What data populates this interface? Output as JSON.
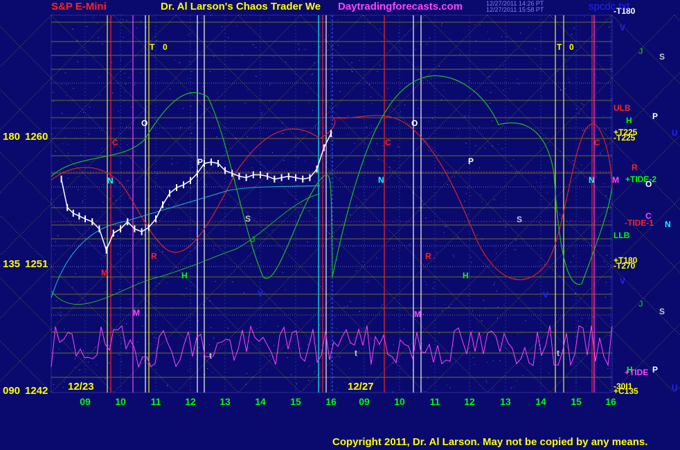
{
  "header": {
    "symbol": "S&P E-Mini",
    "title": "Dr. Al Larson's Chaos Trader We",
    "site": "Daytradingforecasts.com",
    "timestamp1": "12/27/2011 14:26 PT",
    "timestamp2": "12/27/2011 15:58 PT",
    "file": "spcdc.txt"
  },
  "copyright": "Copyright 2011, Dr. Al Larson. May not be copied by any means.",
  "colors": {
    "background": "#0a0a6e",
    "grid": "#b0b000",
    "sides": "#00aa44",
    "yellow_text": "#ffff00",
    "magenta_text": "#ff44ff"
  },
  "chart_data": {
    "type": "line",
    "y_axis_labels": [
      {
        "angle": "180",
        "price": "1260"
      },
      {
        "angle": "135",
        "price": "1251"
      },
      {
        "angle": "090",
        "price": "1242"
      }
    ],
    "ylim": [
      1242,
      1260
    ],
    "x_tick_labels": [
      "09",
      "10",
      "11",
      "12",
      "13",
      "14",
      "15",
      "16",
      "09",
      "10",
      "11",
      "12",
      "13",
      "14",
      "15",
      "16"
    ],
    "date_labels": [
      "12/23",
      "12/27"
    ],
    "price_series": [
      {
        "x": 8.2,
        "y": 1257.0
      },
      {
        "x": 8.4,
        "y": 1255.0
      },
      {
        "x": 8.6,
        "y": 1254.6
      },
      {
        "x": 8.8,
        "y": 1254.4
      },
      {
        "x": 9.0,
        "y": 1254.2
      },
      {
        "x": 9.2,
        "y": 1254.0
      },
      {
        "x": 9.4,
        "y": 1253.5
      },
      {
        "x": 9.6,
        "y": 1252.0
      },
      {
        "x": 9.8,
        "y": 1253.2
      },
      {
        "x": 10.0,
        "y": 1253.5
      },
      {
        "x": 10.2,
        "y": 1254.0
      },
      {
        "x": 10.4,
        "y": 1253.5
      },
      {
        "x": 10.6,
        "y": 1253.3
      },
      {
        "x": 10.8,
        "y": 1253.6
      },
      {
        "x": 11.0,
        "y": 1254.2
      },
      {
        "x": 11.2,
        "y": 1255.2
      },
      {
        "x": 11.4,
        "y": 1256.0
      },
      {
        "x": 11.6,
        "y": 1256.4
      },
      {
        "x": 11.8,
        "y": 1256.6
      },
      {
        "x": 12.0,
        "y": 1256.9
      },
      {
        "x": 12.2,
        "y": 1257.4
      },
      {
        "x": 12.4,
        "y": 1258.1
      },
      {
        "x": 12.6,
        "y": 1258.2
      },
      {
        "x": 12.8,
        "y": 1258.1
      },
      {
        "x": 13.0,
        "y": 1257.6
      },
      {
        "x": 13.2,
        "y": 1257.4
      },
      {
        "x": 13.4,
        "y": 1257.2
      },
      {
        "x": 13.6,
        "y": 1257.1
      },
      {
        "x": 13.8,
        "y": 1257.3
      },
      {
        "x": 14.0,
        "y": 1257.3
      },
      {
        "x": 14.2,
        "y": 1257.2
      },
      {
        "x": 14.4,
        "y": 1257.0
      },
      {
        "x": 14.6,
        "y": 1257.1
      },
      {
        "x": 14.8,
        "y": 1257.2
      },
      {
        "x": 15.0,
        "y": 1257.1
      },
      {
        "x": 15.2,
        "y": 1257.0
      },
      {
        "x": 15.4,
        "y": 1257.1
      },
      {
        "x": 15.6,
        "y": 1257.7
      },
      {
        "x": 15.8,
        "y": 1259.2
      },
      {
        "x": 16.0,
        "y": 1260.2
      }
    ],
    "right_labels": [
      {
        "text": "-T180",
        "color": "#ffffff"
      },
      {
        "text": "V",
        "color": "#2222ff"
      },
      {
        "text": "J",
        "color": "#00aa00"
      },
      {
        "text": "S",
        "color": "#cccccc"
      },
      {
        "text": "ULB",
        "color": "#ff2222"
      },
      {
        "text": "H",
        "color": "#00ff00"
      },
      {
        "text": "P",
        "color": "#ffffff"
      },
      {
        "text": "+T225",
        "color": "#ffff00"
      },
      {
        "text": "-T225",
        "color": "#ffff00"
      },
      {
        "text": "U",
        "color": "#2222ff"
      },
      {
        "text": "R",
        "color": "#ff2222"
      },
      {
        "text": "M",
        "color": "#ff44ff"
      },
      {
        "text": "+TIDE-2",
        "color": "#00ff00"
      },
      {
        "text": "O",
        "color": "#ffffff"
      },
      {
        "text": "C",
        "color": "#ff44ff"
      },
      {
        "text": "-TIDE-1",
        "color": "#ff2222"
      },
      {
        "text": "N",
        "color": "#00ffff"
      },
      {
        "text": "LLB",
        "color": "#00ff00"
      },
      {
        "text": "+T180",
        "color": "#ffff00"
      },
      {
        "text": "-T270",
        "color": "#ffff00"
      },
      {
        "text": "V",
        "color": "#2222ff"
      },
      {
        "text": "J",
        "color": "#00aa00"
      },
      {
        "text": "S",
        "color": "#cccccc"
      },
      {
        "text": "+TIDE",
        "color": "#ff44ff"
      },
      {
        "text": "H",
        "color": "#00ff00"
      },
      {
        "text": "P",
        "color": "#ffffff"
      },
      {
        "text": "-30I1",
        "color": "#ffff00"
      },
      {
        "text": "+C135",
        "color": "#ffff00"
      },
      {
        "text": "U",
        "color": "#2222ff"
      }
    ],
    "plot_letters": [
      {
        "text": "T",
        "color": "#ffff00"
      },
      {
        "text": "0",
        "color": "#ffff00"
      },
      {
        "text": "O",
        "color": "#ffffff"
      },
      {
        "text": "C",
        "color": "#ff2222"
      },
      {
        "text": "N",
        "color": "#00ffff"
      },
      {
        "text": "P",
        "color": "#ffffff"
      },
      {
        "text": "S",
        "color": "#cccccc"
      },
      {
        "text": "R",
        "color": "#ff2222"
      },
      {
        "text": "M",
        "color": "#ff2222"
      },
      {
        "text": "H",
        "color": "#00ff00"
      },
      {
        "text": "J",
        "color": "#00aa00"
      },
      {
        "text": "V",
        "color": "#2222ff"
      },
      {
        "text": "M",
        "color": "#ff44ff"
      },
      {
        "text": "t",
        "color": "#cccccc"
      },
      {
        "text": "O",
        "color": "#ffffff"
      },
      {
        "text": "C",
        "color": "#ff2222"
      },
      {
        "text": "N",
        "color": "#00ffff"
      },
      {
        "text": "P",
        "color": "#ffffff"
      },
      {
        "text": "S",
        "color": "#cccccc"
      },
      {
        "text": "R",
        "color": "#ff2222"
      },
      {
        "text": "H",
        "color": "#00ff00"
      },
      {
        "text": "M",
        "color": "#ff44ff"
      },
      {
        "text": "T",
        "color": "#ffff00"
      },
      {
        "text": "0",
        "color": "#ffff00"
      },
      {
        "text": "V",
        "color": "#2222ff"
      },
      {
        "text": "N",
        "color": "#00ffff"
      },
      {
        "text": "C",
        "color": "#ff2222"
      },
      {
        "text": "t",
        "color": "#cccccc"
      },
      {
        "text": "t",
        "color": "#cccccc"
      }
    ]
  }
}
